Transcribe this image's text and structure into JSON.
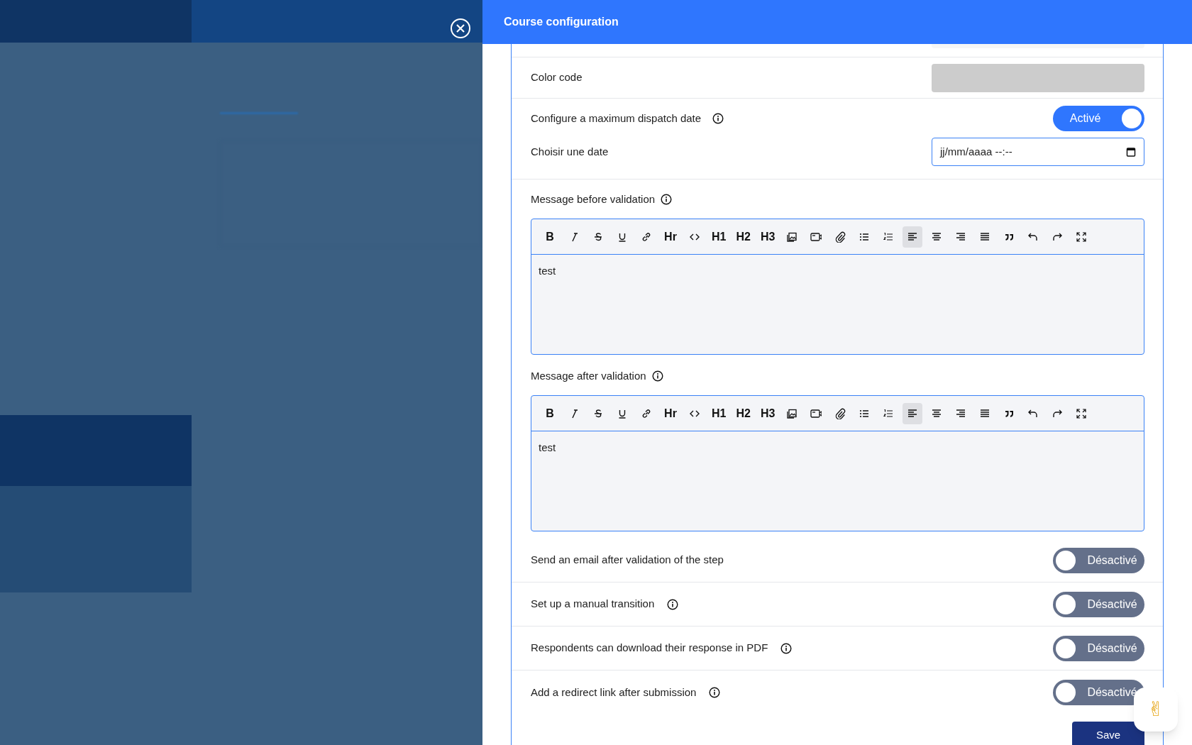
{
  "panel": {
    "title": "Course configuration"
  },
  "color_code": {
    "label": "Color code"
  },
  "dispatch": {
    "label": "Configure a maximum dispatch date",
    "info": true,
    "on": true,
    "toggle_text": "Activé"
  },
  "date": {
    "label": "Choisir une date",
    "value": "jj/mm/aaaa --:--"
  },
  "editors": [
    {
      "label": "Message before validation",
      "info": true,
      "content": "test",
      "toolbar": [
        {
          "kind": "text",
          "label": "B",
          "selected": false
        },
        {
          "kind": "italic",
          "selected": false
        },
        {
          "kind": "strike",
          "selected": false
        },
        {
          "kind": "underline",
          "selected": false
        },
        {
          "kind": "link",
          "selected": false
        },
        {
          "kind": "text",
          "label": "Hr",
          "selected": false
        },
        {
          "kind": "code",
          "selected": false
        },
        {
          "kind": "text",
          "label": "H1",
          "selected": false
        },
        {
          "kind": "text",
          "label": "H2",
          "selected": false
        },
        {
          "kind": "text",
          "label": "H3",
          "selected": false
        },
        {
          "kind": "image",
          "selected": false
        },
        {
          "kind": "video",
          "selected": false
        },
        {
          "kind": "attach",
          "selected": false
        },
        {
          "kind": "bullets",
          "selected": false
        },
        {
          "kind": "numbers",
          "selected": false
        },
        {
          "kind": "alignleft",
          "selected": true
        },
        {
          "kind": "aligncenter",
          "selected": false
        },
        {
          "kind": "alignright",
          "selected": false
        },
        {
          "kind": "justify",
          "selected": false
        },
        {
          "kind": "quote",
          "selected": false
        },
        {
          "kind": "undo",
          "selected": false
        },
        {
          "kind": "redo",
          "selected": false
        },
        {
          "kind": "fullscreen",
          "selected": false
        }
      ]
    },
    {
      "label": "Message after validation",
      "info": true,
      "content": "test",
      "toolbar": [
        {
          "kind": "text",
          "label": "B",
          "selected": false
        },
        {
          "kind": "italic",
          "selected": false
        },
        {
          "kind": "strike",
          "selected": false
        },
        {
          "kind": "underline",
          "selected": false
        },
        {
          "kind": "link",
          "selected": false
        },
        {
          "kind": "text",
          "label": "Hr",
          "selected": false
        },
        {
          "kind": "code",
          "selected": false
        },
        {
          "kind": "text",
          "label": "H1",
          "selected": false
        },
        {
          "kind": "text",
          "label": "H2",
          "selected": false
        },
        {
          "kind": "text",
          "label": "H3",
          "selected": false
        },
        {
          "kind": "image",
          "selected": false
        },
        {
          "kind": "video",
          "selected": false
        },
        {
          "kind": "attach",
          "selected": false
        },
        {
          "kind": "bullets",
          "selected": false
        },
        {
          "kind": "numbers",
          "selected": false
        },
        {
          "kind": "alignleft",
          "selected": true
        },
        {
          "kind": "aligncenter",
          "selected": false
        },
        {
          "kind": "alignright",
          "selected": false
        },
        {
          "kind": "justify",
          "selected": false
        },
        {
          "kind": "quote",
          "selected": false
        },
        {
          "kind": "undo",
          "selected": false
        },
        {
          "kind": "redo",
          "selected": false
        },
        {
          "kind": "fullscreen",
          "selected": false
        }
      ]
    }
  ],
  "toggles": [
    {
      "label": "Send an email after validation of the step",
      "info": false,
      "on": false,
      "text": "Désactivé"
    },
    {
      "label": "Set up a manual transition",
      "info": true,
      "on": false,
      "text": "Désactivé"
    },
    {
      "label": "Respondents can download their response in PDF",
      "info": true,
      "on": false,
      "text": "Désactivé"
    },
    {
      "label": "Add a redirect link after submission",
      "info": true,
      "on": false,
      "text": "Désactivé"
    }
  ],
  "save_button": "Save",
  "chat_button": "✌"
}
